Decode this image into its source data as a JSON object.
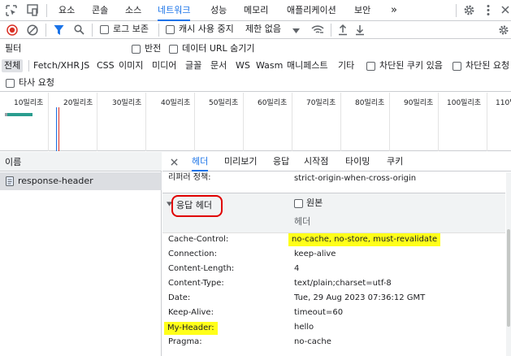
{
  "tabs": [
    {
      "label": "요소"
    },
    {
      "label": "콘솔"
    },
    {
      "label": "소스"
    },
    {
      "label": "네트워크",
      "active": true
    },
    {
      "label": "성능"
    },
    {
      "label": "메모리"
    },
    {
      "label": "애플리케이션"
    },
    {
      "label": "보안"
    }
  ],
  "toolbar": {
    "preserve_log": "로그 보존",
    "disable_cache": "캐시 사용 중지",
    "throttle": "제한 없음"
  },
  "filter": {
    "placeholder": "필터",
    "invert": "반전",
    "hide_data_urls": "데이터 URL 숨기기"
  },
  "types": [
    "전체",
    "Fetch/XHR",
    "JS",
    "CSS",
    "이미지",
    "미디어",
    "글꼴",
    "문서",
    "WS",
    "Wasm",
    "매니페스트",
    "기타"
  ],
  "blocked_cookies": "차단된 쿠키 있음",
  "blocked_requests": "차단된 요청",
  "third_party": "타사 요청",
  "timeline_ticks": [
    "10밀리초",
    "20밀리초",
    "30밀리초",
    "40밀리초",
    "50밀리초",
    "60밀리초",
    "70밀리초",
    "80밀리초",
    "90밀리초",
    "100밀리초",
    "110밀"
  ],
  "request_list": {
    "header": "이름",
    "items": [
      {
        "name": "response-header"
      }
    ]
  },
  "detail_tabs": [
    "헤더",
    "미리보기",
    "응답",
    "시작점",
    "타이밍",
    "쿠키"
  ],
  "referrer_policy": {
    "key": "리퍼러 정책:",
    "value": "strict-origin-when-cross-origin"
  },
  "response_headers": {
    "title": "응답 헤더",
    "raw": "원본",
    "col": "헤더",
    "rows": [
      {
        "key": "Cache-Control:",
        "value": "no-cache, no-store, must-revalidate"
      },
      {
        "key": "Connection:",
        "value": "keep-alive"
      },
      {
        "key": "Content-Length:",
        "value": "4"
      },
      {
        "key": "Content-Type:",
        "value": "text/plain;charset=utf-8"
      },
      {
        "key": "Date:",
        "value": "Tue, 29 Aug 2023 07:36:12 GMT"
      },
      {
        "key": "Keep-Alive:",
        "value": "timeout=60"
      },
      {
        "key": "My-Header:",
        "value": "hello"
      },
      {
        "key": "Pragma:",
        "value": "no-cache"
      }
    ]
  },
  "colors": {
    "accent": "#1a73e8",
    "highlight": "#ffff1a",
    "annotation": "#e00000",
    "record": "#d93025"
  }
}
